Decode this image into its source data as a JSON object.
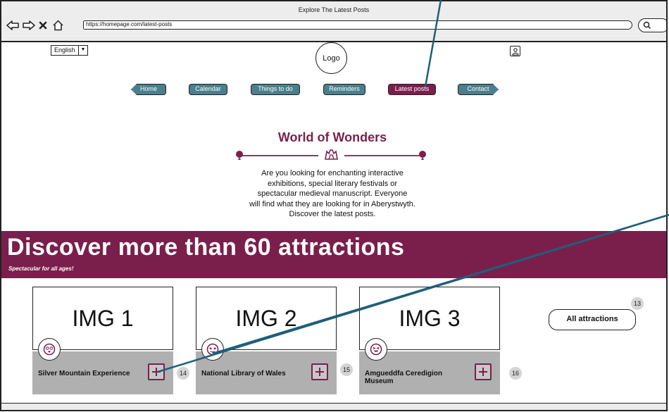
{
  "window": {
    "title": "Explore The Latest Posts",
    "url": "https://homepage.com/latest-posts"
  },
  "header": {
    "language": "English",
    "logo": "Logo"
  },
  "nav": {
    "tabs": [
      {
        "label": "Home",
        "active": false
      },
      {
        "label": "Calendar",
        "active": false
      },
      {
        "label": "Things to do",
        "active": false
      },
      {
        "label": "Reminders",
        "active": false
      },
      {
        "label": "Latest posts",
        "active": true
      },
      {
        "label": "Contact",
        "active": false
      }
    ]
  },
  "hero": {
    "title": "World of Wonders",
    "lines": [
      "Are you looking for enchanting interactive",
      "exhibitions, special literary festivals or",
      "spectacular medieval manuscript. Everyone",
      "will find what they are looking for in Aberystwyth.",
      "Discover the latest posts."
    ]
  },
  "banner": {
    "title": "Discover more than 60 attractions",
    "subtitle": "Spectacular for all ages!"
  },
  "cards": [
    {
      "image": "IMG 1",
      "name": "Silver Mountain Experience",
      "marker": "14",
      "icon": "dizzy-face-icon"
    },
    {
      "image": "IMG 2",
      "name": "National Library of Wales",
      "marker": "15",
      "icon": "star-eyes-face-icon"
    },
    {
      "image": "IMG 3",
      "name": "Amgueddfa Ceredigion Museum",
      "marker": "16",
      "icon": "laughing-face-icon"
    }
  ],
  "all_attractions": {
    "label": "All attractions",
    "marker": "13"
  },
  "colors": {
    "accent": "#7a1f4c",
    "tab": "#4a7f8b",
    "callout": "#1f5f7a"
  }
}
